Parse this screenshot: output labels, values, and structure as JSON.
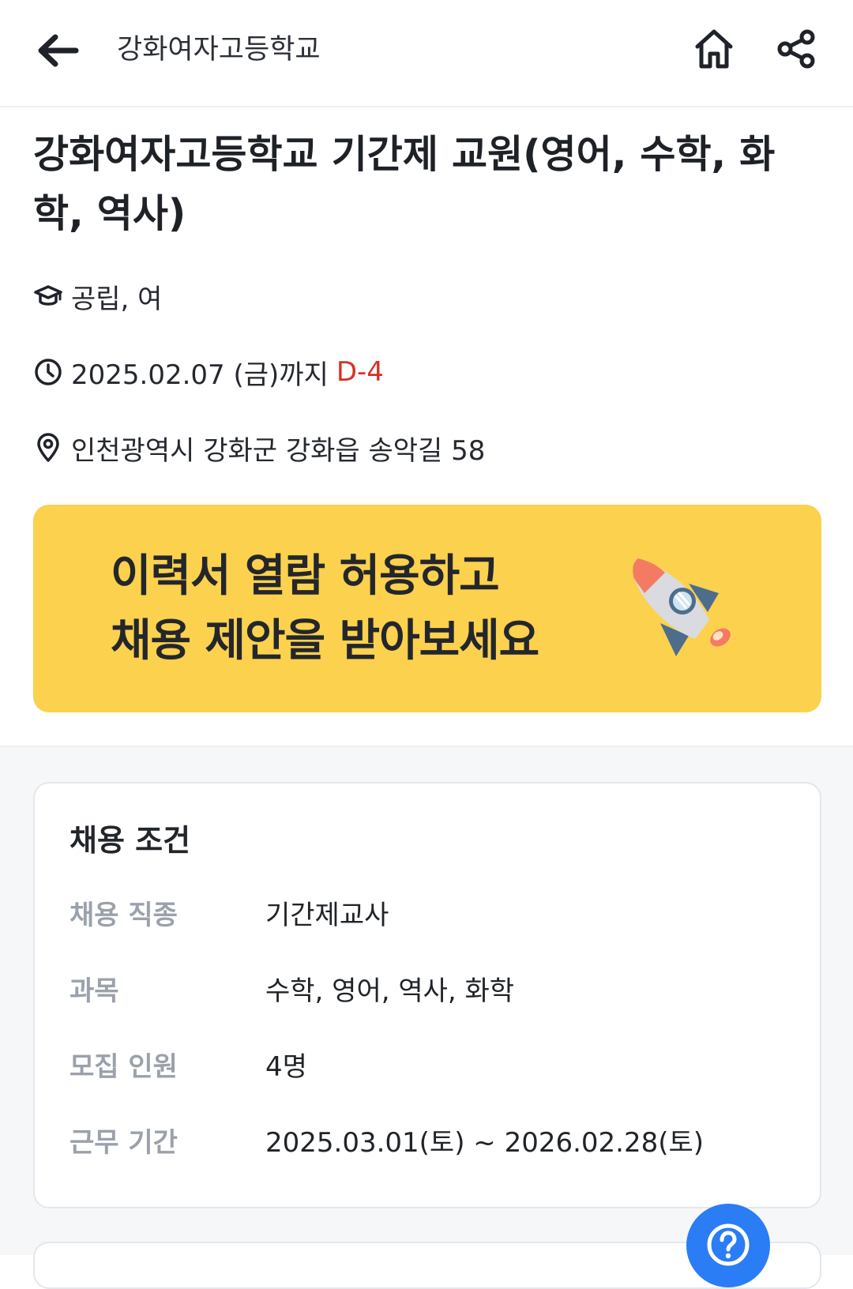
{
  "header": {
    "title": "강화여자고등학교",
    "back_icon": "arrow-left-icon",
    "home_icon": "home-icon",
    "share_icon": "share-icon"
  },
  "job": {
    "title": "강화여자고등학교 기간제 교원(영어, 수학, 화학, 역사)",
    "school_type": "공립, 여",
    "deadline": "2025.02.07 (금)까지",
    "dday": "D-4",
    "address": "인천광역시 강화군 강화읍 송악길 58"
  },
  "banner": {
    "line1": "이력서 열람 허용하고",
    "line2": "채용 제안을 받아보세요",
    "background": "#fcd14e"
  },
  "conditions": {
    "title": "채용 조건",
    "rows": [
      {
        "label": "채용 직종",
        "value": "기간제교사"
      },
      {
        "label": "과목",
        "value": "수학, 영어, 역사, 화학"
      },
      {
        "label": "모집 인원",
        "value": "4명"
      },
      {
        "label": "근무 기간",
        "value": "2025.03.01(토) ~ 2026.02.28(토)"
      }
    ]
  },
  "colors": {
    "accent": "#2a7df4",
    "dday": "#d93025",
    "label": "#9aa1ab"
  }
}
